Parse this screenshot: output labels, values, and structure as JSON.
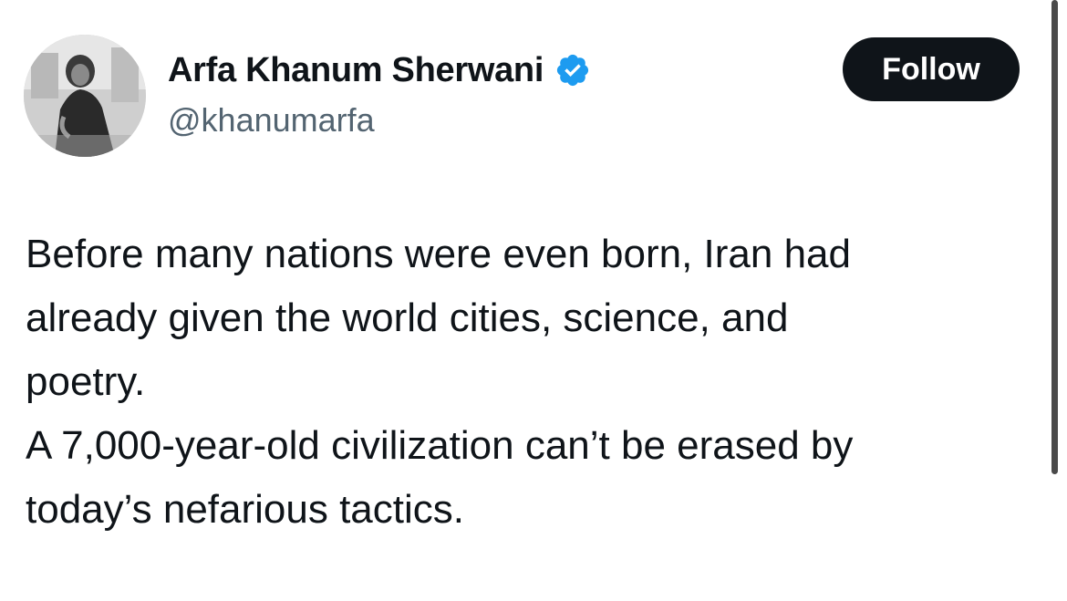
{
  "tweet": {
    "author": {
      "display_name": "Arfa Khanum Sherwani",
      "handle": "@khanumarfa",
      "verified": true,
      "verified_icon": "verified-badge-icon",
      "verified_color": "#1d9bf0"
    },
    "follow_label": "Follow",
    "body_lines": [
      "Before many nations were even born, Iran had",
      "already given the world cities, science, and",
      "poetry.",
      "A 7,000-year-old civilization can’t be erased by",
      "today’s nefarious tactics."
    ]
  },
  "colors": {
    "text_primary": "#0f1419",
    "text_secondary": "#536471",
    "button_bg": "#0f1419",
    "button_text": "#ffffff",
    "background": "#ffffff"
  }
}
